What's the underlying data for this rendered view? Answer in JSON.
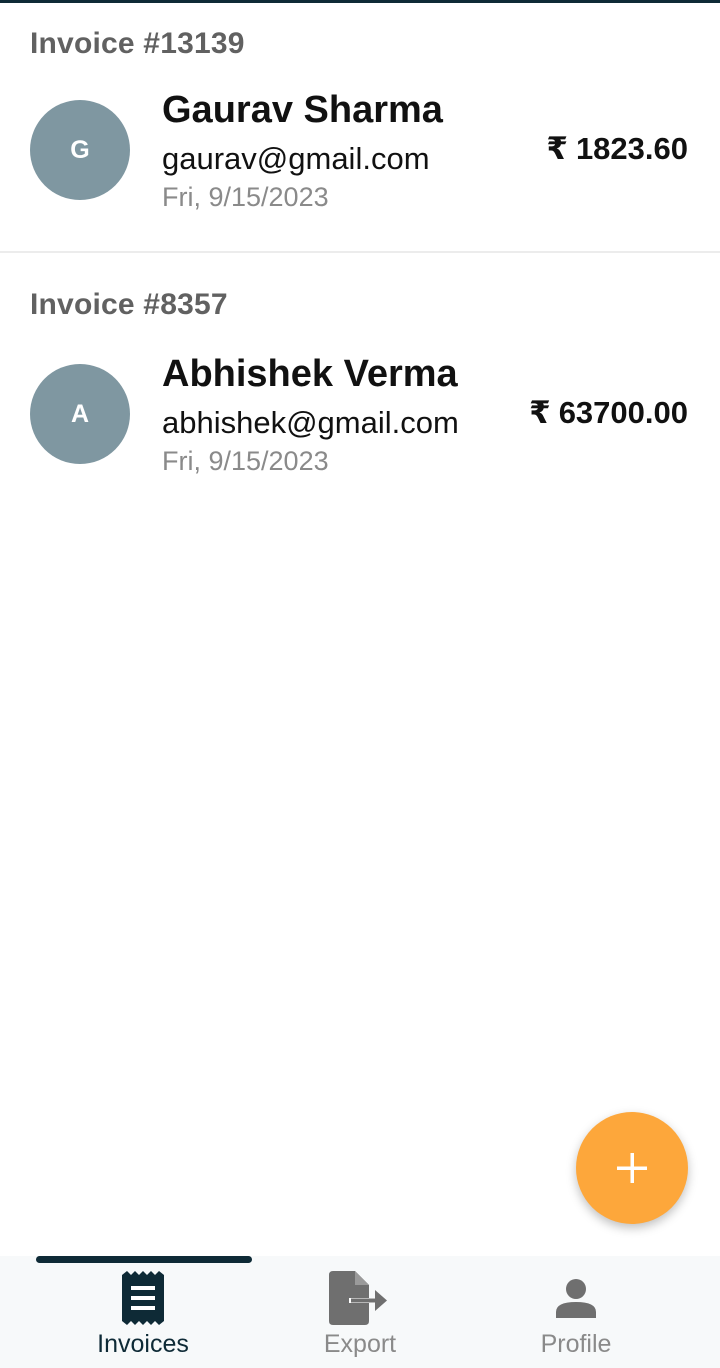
{
  "invoices": [
    {
      "number_label": "Invoice #13139",
      "avatar_initial": "G",
      "name": "Gaurav Sharma",
      "email": "gaurav@gmail.com",
      "date": "Fri, 9/15/2023",
      "currency_symbol": "₹",
      "amount": "1823.60"
    },
    {
      "number_label": "Invoice #8357",
      "avatar_initial": "A",
      "name": "Abhishek Verma",
      "email": "abhishek@gmail.com",
      "date": "Fri, 9/15/2023",
      "currency_symbol": "₹",
      "amount": "63700.00"
    }
  ],
  "fab": {
    "icon": "plus-icon"
  },
  "bottom_nav": {
    "items": [
      {
        "label": "Invoices",
        "icon": "receipt-icon",
        "active": true
      },
      {
        "label": "Export",
        "icon": "file-export-icon",
        "active": false
      },
      {
        "label": "Profile",
        "icon": "person-icon",
        "active": false
      }
    ]
  },
  "colors": {
    "accent_dark": "#0e2a36",
    "fab": "#fda73b",
    "avatar": "#7f97a1",
    "muted_text": "#8a8a8a",
    "invoice_label": "#616161"
  }
}
